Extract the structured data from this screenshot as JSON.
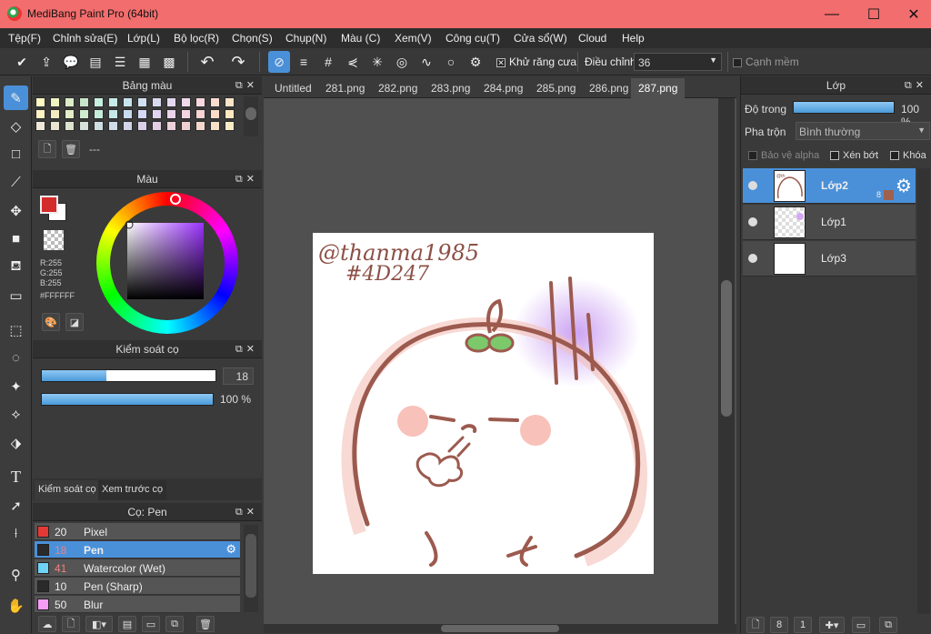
{
  "window": {
    "title": "MediBang Paint Pro (64bit)",
    "min_glyph": "—",
    "max_glyph": "☐",
    "close_glyph": "✕"
  },
  "menu": [
    "Tệp(F)",
    "Chỉnh sửa(E)",
    "Lớp(L)",
    "Bộ lọc(R)",
    "Chọn(S)",
    "Chụp(N)",
    "Màu (C)",
    "Xem(V)",
    "Công cụ(T)",
    "Cửa sổ(W)",
    "Cloud",
    "Help"
  ],
  "toolbar": {
    "antialias_label": "Khử răng cưa",
    "antialias_checked": "✕",
    "correction_label": "Điều chỉnh",
    "correction_value": "36",
    "soft_edge_label": "Cạnh mềm"
  },
  "palette_panel": {
    "title": "Bảng màu",
    "palette_name": "---",
    "swatches": [
      "#fff9c4",
      "#f0f4c3",
      "#dcedc8",
      "#c8e6c9",
      "#c8f0e0",
      "#c8ece8",
      "#c8e4ec",
      "#d0e0f0",
      "#d8d8f0",
      "#e4d8f0",
      "#f0d8ec",
      "#f8d8e0",
      "#fadcd0",
      "#fce4c8",
      "#fff3c4",
      "#f4ecc0",
      "#e4eec8",
      "#d0ecd0",
      "#c8ecdc",
      "#c4e8e8",
      "#c8dcf0",
      "#d4d8f4",
      "#e0d4f0",
      "#ecd4ec",
      "#f4d4e0",
      "#f8d4d4",
      "#fcdcc8",
      "#fde8c0",
      "#f0e8d8",
      "#e8e4d0",
      "#dce4d0",
      "#d4e0d8",
      "#d0e0e0",
      "#d0dce8",
      "#d4d4e8",
      "#dcd0e8",
      "#e4d0e4",
      "#ecd0dc",
      "#f0d0d0",
      "#f4d8cc",
      "#f8e0c8",
      "#f8ecc8"
    ]
  },
  "color_panel": {
    "title": "Màu",
    "r_text": "R:255",
    "g_text": "G:255",
    "b_text": "B:255",
    "hex_text": "#FFFFFF",
    "foreground": "#d42b2b",
    "background": "#ffffff"
  },
  "brush_control": {
    "title": "Kiểm soát cọ",
    "size_value": "18",
    "size_fraction": 0.37,
    "opacity_value": "100 %",
    "opacity_fraction": 1.0,
    "tab_control": "Kiểm soát cọ",
    "tab_preview": "Xem trước cọ"
  },
  "brush_panel": {
    "title": "Cọ: Pen",
    "brushes": [
      {
        "color": "#e53935",
        "size": "20",
        "name": "Pixel",
        "selected": false
      },
      {
        "color": "#2a2a2a",
        "size": "18",
        "name": "Pen",
        "selected": true
      },
      {
        "color": "#6fd3f5",
        "size": "41",
        "name": "Watercolor (Wet)",
        "selected": false
      },
      {
        "color": "#2a2a2a",
        "size": "10",
        "name": "Pen (Sharp)",
        "selected": false
      },
      {
        "color": "#f59cf5",
        "size": "50",
        "name": "Blur",
        "selected": false
      }
    ]
  },
  "tabs": [
    "Untitled",
    "281.png",
    "282.png",
    "283.png",
    "284.png",
    "285.png",
    "286.png",
    "287.png"
  ],
  "active_tab": "287.png",
  "drawing": {
    "handwriting_line1": "@thanma1985",
    "handwriting_line2": "#4D247"
  },
  "layer_panel": {
    "title": "Lớp",
    "opacity_label": "Độ trong",
    "opacity_value": "100 %",
    "blend_label": "Pha trộn",
    "blend_value": "Bình thường",
    "protect_alpha": "Bảo vệ alpha",
    "clipping": "Xén bớt",
    "lock": "Khóa",
    "layers": [
      {
        "name": "Lớp2",
        "selected": true,
        "badge": "8"
      },
      {
        "name": "Lớp1",
        "selected": false,
        "badge": ""
      },
      {
        "name": "Lớp3",
        "selected": false,
        "badge": ""
      }
    ]
  }
}
